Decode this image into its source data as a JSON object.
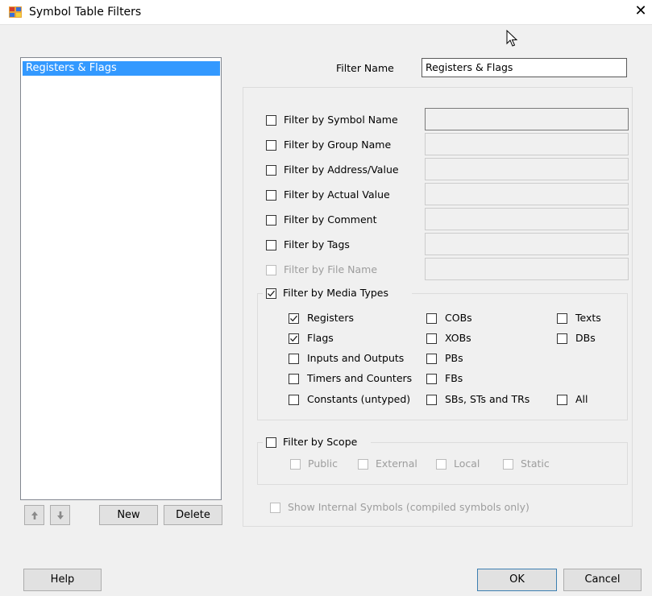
{
  "window": {
    "title": "Symbol Table Filters",
    "close_label": "✕"
  },
  "filters_list": {
    "items": [
      "Registers & Flags"
    ]
  },
  "list_buttons": {
    "up": "🡅",
    "down": "🡇",
    "new": "New",
    "delete": "Delete"
  },
  "filter_name": {
    "label": "Filter Name",
    "value": "Registers & Flags"
  },
  "filters": [
    {
      "label": "Filter by Symbol Name",
      "checked": false,
      "enabled": true,
      "value": ""
    },
    {
      "label": "Filter by Group Name",
      "checked": false,
      "enabled": true,
      "value": ""
    },
    {
      "label": "Filter by Address/Value",
      "checked": false,
      "enabled": true,
      "value": ""
    },
    {
      "label": "Filter by Actual Value",
      "checked": false,
      "enabled": true,
      "value": ""
    },
    {
      "label": "Filter by Comment",
      "checked": false,
      "enabled": true,
      "value": ""
    },
    {
      "label": "Filter by Tags",
      "checked": false,
      "enabled": true,
      "value": ""
    },
    {
      "label": "Filter by File Name",
      "checked": false,
      "enabled": false,
      "value": ""
    }
  ],
  "media_types": {
    "label": "Filter by Media Types",
    "checked": true,
    "items": [
      {
        "label": "Registers",
        "checked": true
      },
      {
        "label": "Flags",
        "checked": true
      },
      {
        "label": "Inputs and Outputs",
        "checked": false
      },
      {
        "label": "Timers and Counters",
        "checked": false
      },
      {
        "label": "Constants (untyped)",
        "checked": false
      },
      {
        "label": "COBs",
        "checked": false
      },
      {
        "label": "XOBs",
        "checked": false
      },
      {
        "label": "PBs",
        "checked": false
      },
      {
        "label": "FBs",
        "checked": false
      },
      {
        "label": "SBs, STs and TRs",
        "checked": false
      },
      {
        "label": "Texts",
        "checked": false
      },
      {
        "label": "DBs",
        "checked": false
      },
      {
        "label": "All",
        "checked": false
      }
    ]
  },
  "scope": {
    "label": "Filter by Scope",
    "checked": false,
    "items": [
      {
        "label": "Public",
        "checked": false
      },
      {
        "label": "External",
        "checked": false
      },
      {
        "label": "Local",
        "checked": false
      },
      {
        "label": "Static",
        "checked": false
      }
    ]
  },
  "internal_symbols": {
    "label": "Show Internal Symbols (compiled symbols only)",
    "checked": false
  },
  "footer": {
    "help": "Help",
    "ok": "OK",
    "cancel": "Cancel"
  }
}
